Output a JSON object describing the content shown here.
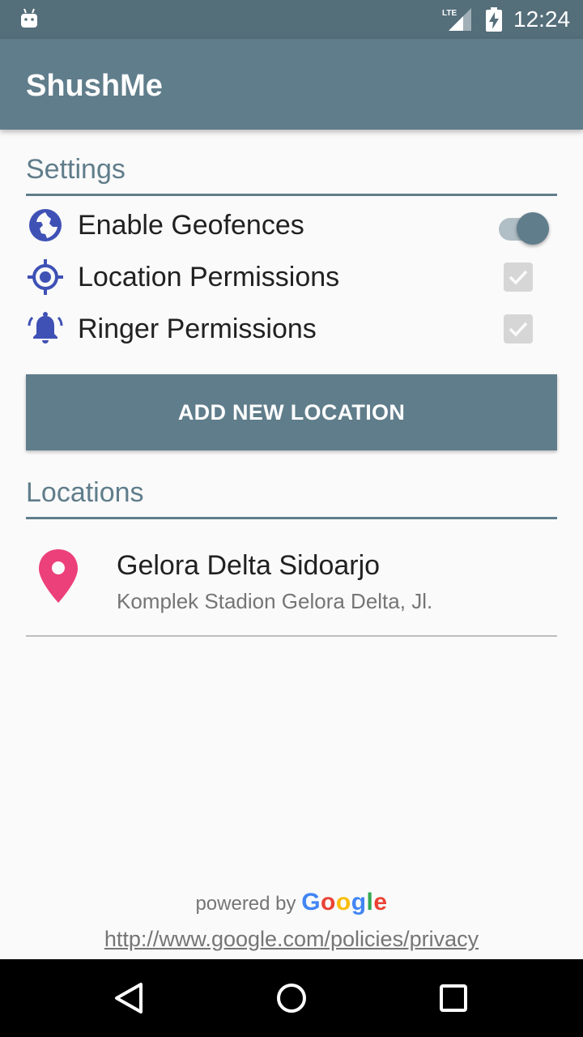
{
  "status_bar": {
    "network": "LTE",
    "time": "12:24"
  },
  "app_bar": {
    "title": "ShushMe"
  },
  "settings": {
    "header": "Settings",
    "items": [
      {
        "label": "Enable Geofences",
        "icon": "globe-icon",
        "control": "toggle",
        "checked": true
      },
      {
        "label": "Location Permissions",
        "icon": "location-target-icon",
        "control": "checkbox",
        "checked": true,
        "disabled": true
      },
      {
        "label": "Ringer Permissions",
        "icon": "ringer-bell-icon",
        "control": "checkbox",
        "checked": true,
        "disabled": true
      }
    ]
  },
  "add_location_button": {
    "label": "ADD NEW LOCATION"
  },
  "locations": {
    "header": "Locations",
    "items": [
      {
        "name": "Gelora Delta Sidoarjo",
        "address": "Komplek Stadion Gelora Delta, Jl.",
        "icon": "map-pin-icon"
      }
    ]
  },
  "footer": {
    "powered_by": "powered by",
    "google_letters": [
      "G",
      "o",
      "o",
      "g",
      "l",
      "e"
    ],
    "privacy_url": "http://www.google.com/policies/privacy"
  },
  "colors": {
    "primary": "#607d8b",
    "primary_dark": "#546e7a",
    "icon_blue": "#3f51b5",
    "pin_pink": "#ec407a",
    "toggle_track": "#b0bec5"
  },
  "nav_bar": {
    "buttons": [
      "back-icon",
      "home-icon",
      "recents-icon"
    ]
  }
}
